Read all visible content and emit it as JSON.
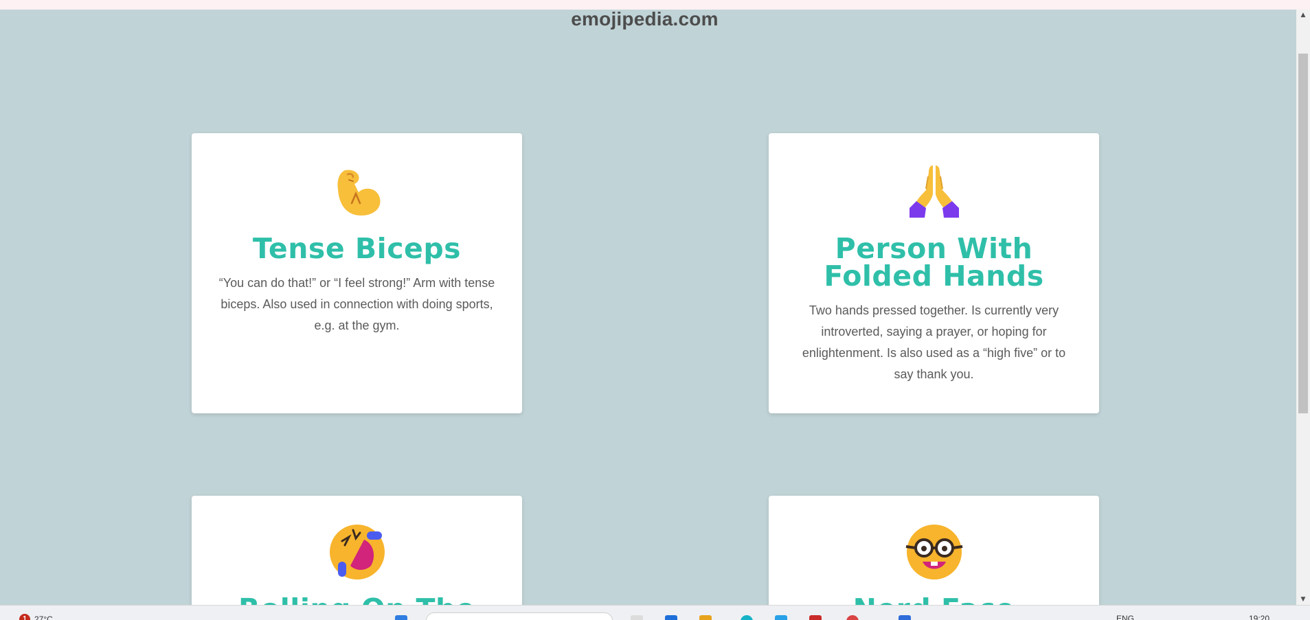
{
  "site": {
    "title": "emojipedia.com"
  },
  "cards": [
    {
      "title": "Tense Biceps",
      "description": "“You can do that!” or “I feel strong!” Arm with tense biceps. Also used in connection with doing sports, e.g. at the gym.",
      "icon": "flexed-biceps-icon"
    },
    {
      "title": "Person With Folded Hands",
      "description": "Two hands pressed together. Is currently very introverted, saying a prayer, or hoping for enlightenment. Is also used as a “high five” or to say thank you.",
      "icon": "folded-hands-icon"
    },
    {
      "title": "Rolling On The",
      "description": "",
      "icon": "rolling-laughing-icon"
    },
    {
      "title": "Nerd Face",
      "description": "",
      "icon": "nerd-face-icon"
    }
  ],
  "taskbar": {
    "notification_count": "1",
    "temperature": "27°C",
    "language": "ENG",
    "time": "19:20"
  },
  "colors": {
    "background": "#c0d3d6",
    "card_title": "#2fbfa9",
    "card_text": "#5a5a5a",
    "site_title": "#4d4d4d"
  }
}
